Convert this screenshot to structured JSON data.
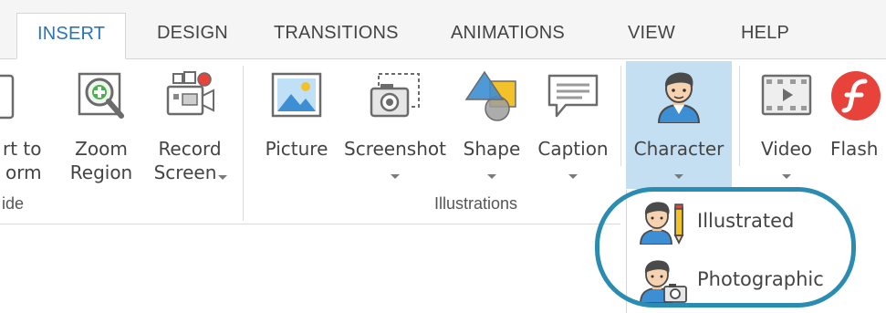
{
  "tabs": [
    {
      "label": "INSERT",
      "active": true
    },
    {
      "label": "DESIGN",
      "active": false
    },
    {
      "label": "TRANSITIONS",
      "active": false
    },
    {
      "label": "ANIMATIONS",
      "active": false
    },
    {
      "label": "VIEW",
      "active": false
    },
    {
      "label": "HELP",
      "active": false
    }
  ],
  "ribbon": {
    "slide_group": {
      "label": "ide",
      "buttons": {
        "convert": {
          "line1": "rt to",
          "line2": "orm",
          "icon": "form-icon"
        },
        "zoom": {
          "line1": "Zoom",
          "line2": "Region",
          "icon": "zoom-region-icon"
        },
        "record": {
          "line1": "Record",
          "line2": "Screen",
          "icon": "record-screen-icon",
          "has_dropdown": true
        }
      }
    },
    "illustrations_group": {
      "label": "Illustrations",
      "buttons": {
        "picture": {
          "label": "Picture",
          "icon": "picture-icon"
        },
        "screenshot": {
          "label": "Screenshot",
          "icon": "screenshot-icon",
          "has_dropdown": true
        },
        "shape": {
          "label": "Shape",
          "icon": "shape-icon",
          "has_dropdown": true
        },
        "caption": {
          "label": "Caption",
          "icon": "caption-icon",
          "has_dropdown": true
        },
        "character": {
          "label": "Character",
          "icon": "character-icon",
          "has_dropdown": true,
          "selected": true
        }
      }
    },
    "media_group": {
      "buttons": {
        "video": {
          "label": "Video",
          "icon": "video-icon",
          "has_dropdown": true
        },
        "flash": {
          "label": "Flash",
          "icon": "flash-icon"
        }
      }
    }
  },
  "character_menu": {
    "items": [
      {
        "label": "Illustrated",
        "icon": "illustrated-character-icon"
      },
      {
        "label": "Photographic",
        "icon": "photographic-character-icon"
      }
    ],
    "highlight_color": "#2a8cb0"
  },
  "colors": {
    "accent": "#2a73b8",
    "selected_bg": "#c5dff2",
    "flash_red": "#e8433a"
  }
}
